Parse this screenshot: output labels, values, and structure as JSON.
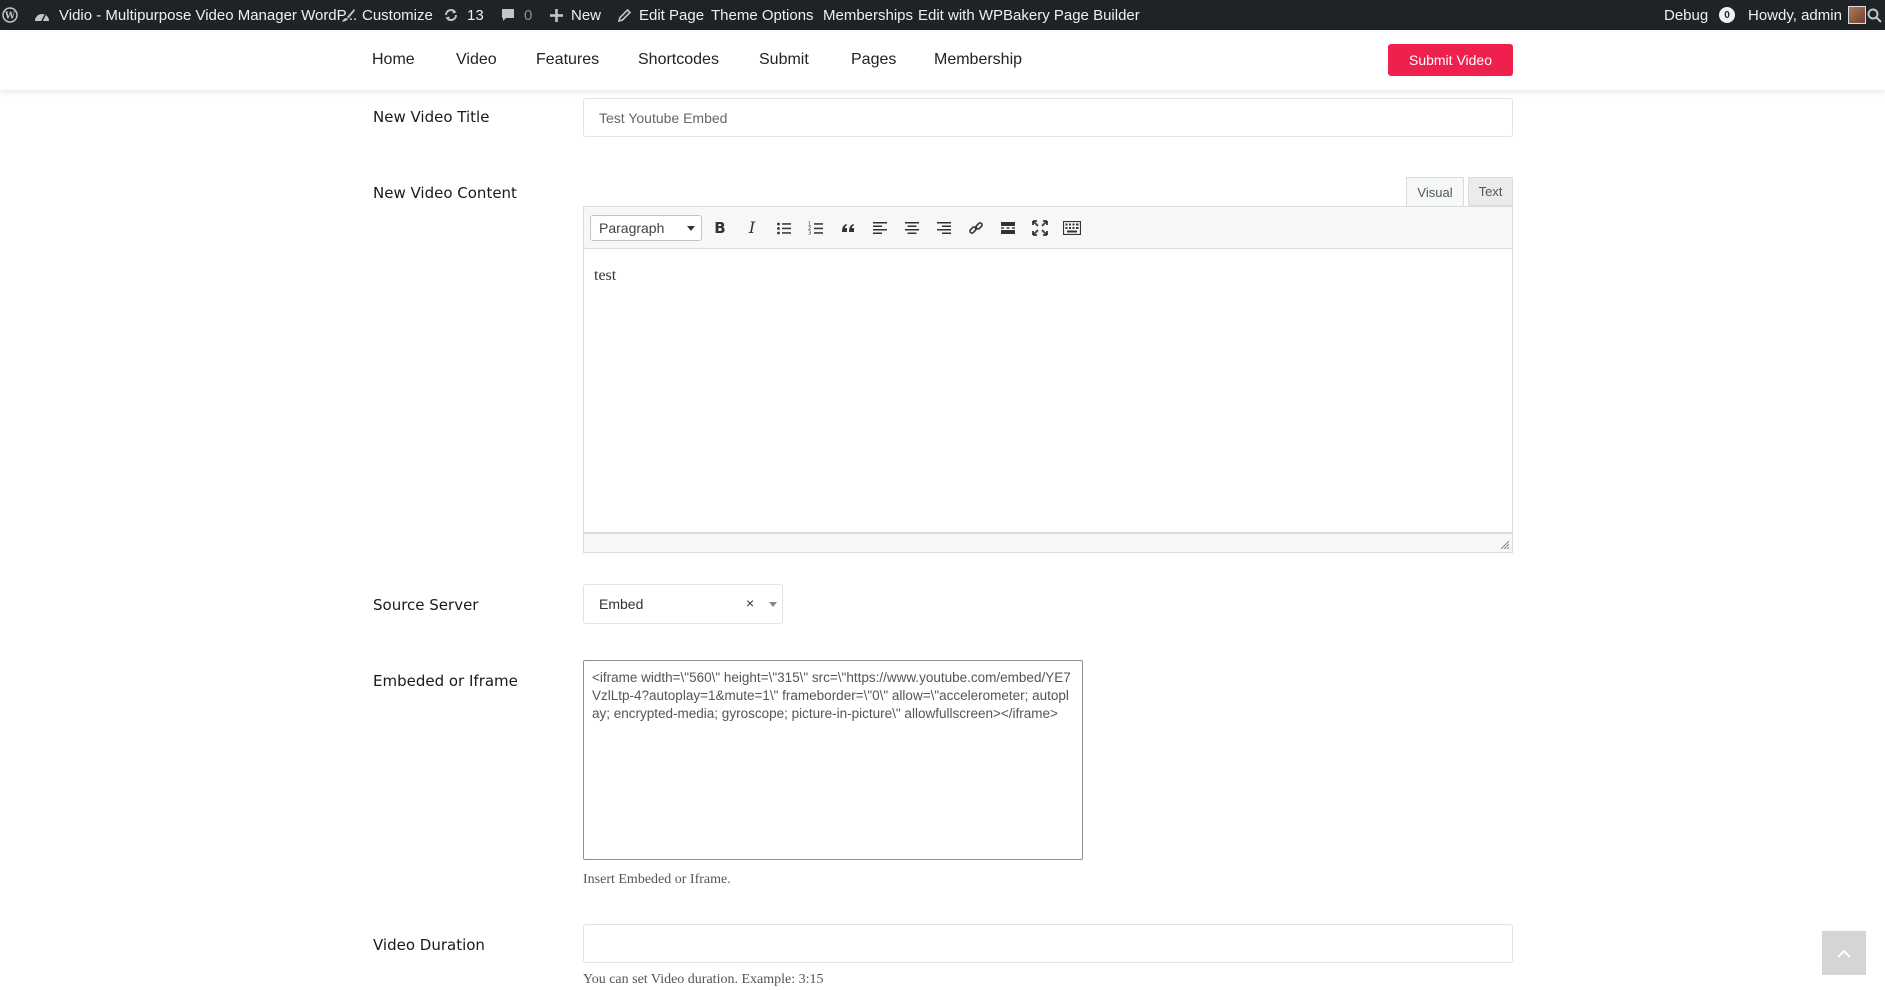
{
  "admin_bar": {
    "site_title": "Vidio - Multipurpose Video Manager WordP...",
    "customize": "Customize",
    "updates_count": "13",
    "comments_count": "0",
    "new": "New",
    "edit_page": "Edit Page",
    "theme_options": "Theme Options",
    "memberships": "Memberships",
    "wpbakery": "Edit with WPBakery Page Builder",
    "debug": "Debug",
    "notification_count": "0",
    "howdy": "Howdy, admin"
  },
  "nav": {
    "items": [
      "Home",
      "Video",
      "Features",
      "Shortcodes",
      "Submit",
      "Pages",
      "Membership"
    ],
    "submit_button": "Submit Video",
    "accent_color": "#f0204e"
  },
  "form": {
    "title_label": "New Video Title",
    "title_value": "Test Youtube Embed",
    "content_label": "New Video Content",
    "editor": {
      "tab_visual": "Visual",
      "tab_text": "Text",
      "format_select": "Paragraph",
      "toolbar_icons": [
        "bold-icon",
        "italic-icon",
        "bullet-list-icon",
        "numbered-list-icon",
        "blockquote-icon",
        "align-left-icon",
        "align-center-icon",
        "align-right-icon",
        "link-icon",
        "read-more-icon",
        "fullscreen-icon",
        "toolbar-toggle-icon"
      ],
      "content": "test"
    },
    "source_label": "Source Server",
    "source_value": "Embed",
    "embed_label": "Embeded or Iframe",
    "embed_value": "<iframe width=\\\"560\\\" height=\\\"315\\\" src=\\\"https://www.youtube.com/embed/YE7VzlLtp-4?autoplay=1&mute=1\\\" frameborder=\\\"0\\\" allow=\\\"accelerometer; autoplay; encrypted-media; gyroscope; picture-in-picture\\\" allowfullscreen></iframe>",
    "embed_help": "Insert Embeded or Iframe.",
    "duration_label": "Video Duration",
    "duration_value": "",
    "duration_help": "You can set Video duration. Example: 3:15"
  }
}
